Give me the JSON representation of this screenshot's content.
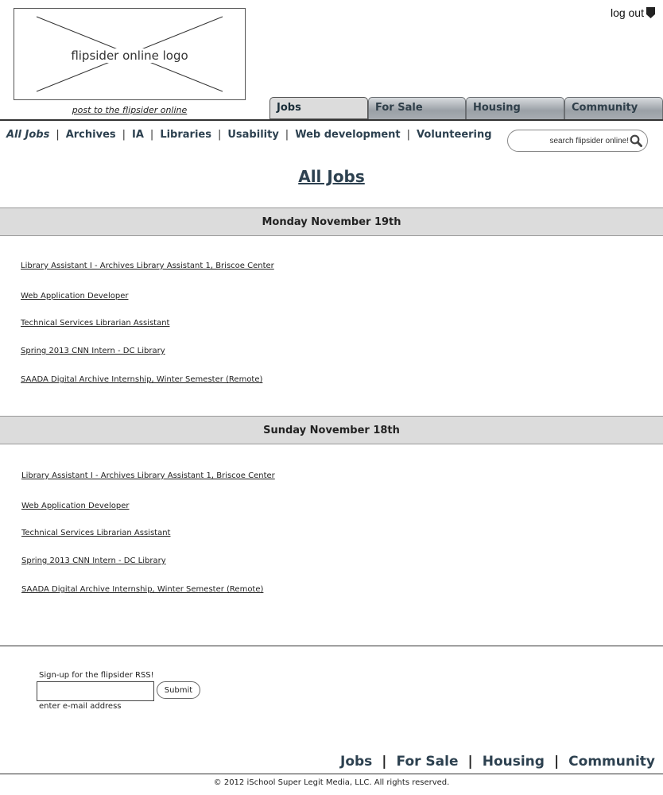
{
  "header": {
    "logo_text": "flipsider online logo",
    "post_link": "post to the flipsider online",
    "logout_label": "log out"
  },
  "tabs": [
    {
      "label": "Jobs",
      "active": true
    },
    {
      "label": "For Sale",
      "active": false
    },
    {
      "label": "Housing",
      "active": false
    },
    {
      "label": "Community",
      "active": false
    }
  ],
  "subnav": [
    {
      "label": "All Jobs",
      "current": true
    },
    {
      "label": "Archives"
    },
    {
      "label": "IA"
    },
    {
      "label": "Libraries"
    },
    {
      "label": "Usability"
    },
    {
      "label": "Web development"
    },
    {
      "label": "Volunteering"
    }
  ],
  "subnav_separator": "|",
  "search": {
    "placeholder": "search flipsider online!",
    "icon": "search-icon"
  },
  "page_title": "All Jobs",
  "days": [
    {
      "date": "Monday November 19th",
      "jobs": [
        "Library Assistant I - Archives Library Assistant 1, Briscoe Center",
        "Web Application Developer",
        "Technical Services Librarian Assistant",
        "Spring 2013 CNN Intern - DC Library",
        "SAADA Digital Archive Internship, Winter Semester (Remote)"
      ]
    },
    {
      "date": "Sunday November 18th",
      "jobs": [
        "Library Assistant I - Archives Library Assistant 1, Briscoe Center",
        "Web Application Developer",
        "Technical Services Librarian Assistant",
        "Spring 2013 CNN Intern - DC Library",
        "SAADA Digital Archive Internship, Winter Semester (Remote)"
      ]
    }
  ],
  "rss": {
    "label": "Sign-up for the flipsider RSS!",
    "submit_label": "Submit",
    "hint": "enter e-mail address",
    "email_value": ""
  },
  "footer": {
    "nav": [
      "Jobs",
      "For Sale",
      "Housing",
      "Community"
    ],
    "separator": "|",
    "copyright": "© 2012 iSchool Super Legit Media, LLC. All rights reserved."
  },
  "colors": {
    "nav_text": "#2d4150",
    "day_bar": "#dcdcdc",
    "tab_gradient": "#9aa0a6"
  }
}
